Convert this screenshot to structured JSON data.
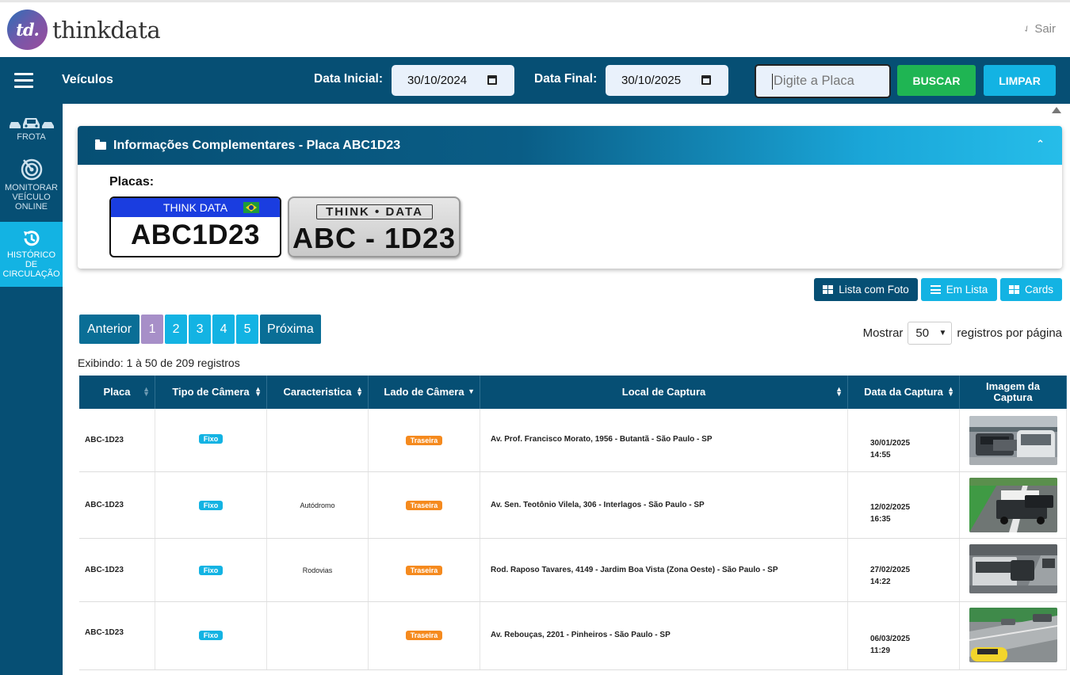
{
  "brand": {
    "logo_mark": "td.",
    "name": "thinkdata"
  },
  "header": {
    "logout_label": "Sair"
  },
  "navbar": {
    "page_title": "Veículos",
    "start_date_label": "Data Inicial:",
    "start_date_value": "30/10/2024",
    "end_date_label": "Data Final:",
    "end_date_value": "30/10/2025",
    "plate_placeholder": "Digite a Placa",
    "search_button": "BUSCAR",
    "clear_button": "LIMPAR"
  },
  "sidebar": {
    "items": [
      {
        "label": "FROTA",
        "icon": "cars-icon",
        "active": false
      },
      {
        "label": "MONITORAR VEÍCULO ONLINE",
        "icon": "radar-icon",
        "active": false
      },
      {
        "label": "HISTÓRICO DE CIRCULAÇÃO",
        "icon": "history-icon",
        "active": true
      }
    ]
  },
  "info_panel": {
    "title": "Informações Complementares - Placa ABC1D23",
    "plates_label": "Placas:",
    "mercosul_plate": {
      "header": "THINK DATA",
      "number": "ABC1D23"
    },
    "old_plate": {
      "header": "THINK • DATA",
      "number": "ABC - 1D23"
    }
  },
  "view_toggle": {
    "photo_list": "Lista com Foto",
    "list": "Em Lista",
    "cards": "Cards"
  },
  "pagination": {
    "prev": "Anterior",
    "pages": [
      "1",
      "2",
      "3",
      "4",
      "5"
    ],
    "current": "1",
    "next": "Próxima"
  },
  "page_size": {
    "show_label": "Mostrar",
    "value": "50",
    "suffix": "registros por página"
  },
  "summary": "Exibindo: 1 à 50 de 209 registros",
  "table": {
    "columns": [
      "Placa",
      "Tipo de Câmera",
      "Caracteristica",
      "Lado de Câmera",
      "Local de Captura",
      "Data da Captura",
      "Imagem da Captura"
    ],
    "rows": [
      {
        "placa": "ABC-1D23",
        "tipo": "Fixo",
        "caracteristica": "",
        "lado": "Traseira",
        "local": "Av. Prof. Francisco Morato, 1956 - Butantã - São Paulo - SP",
        "data": "30/01/2025",
        "hora": "14:55"
      },
      {
        "placa": "ABC-1D23",
        "tipo": "Fixo",
        "caracteristica": "Autódromo",
        "lado": "Traseira",
        "local": "Av. Sen. Teotônio Vilela, 306 - Interlagos - São Paulo - SP",
        "data": "12/02/2025",
        "hora": "16:35"
      },
      {
        "placa": "ABC-1D23",
        "tipo": "Fixo",
        "caracteristica": "Rodovias",
        "lado": "Traseira",
        "local": "Rod. Raposo Tavares, 4149 - Jardim Boa Vista (Zona Oeste) - São Paulo - SP",
        "data": "27/02/2025",
        "hora": "14:22"
      },
      {
        "placa": "ABC-1D23",
        "tipo": "Fixo",
        "caracteristica": "",
        "lado": "Traseira",
        "local": "Av. Rebouças, 2201 - Pinheiros - São Paulo - SP",
        "data": "06/03/2025",
        "hora": "11:29"
      }
    ]
  }
}
